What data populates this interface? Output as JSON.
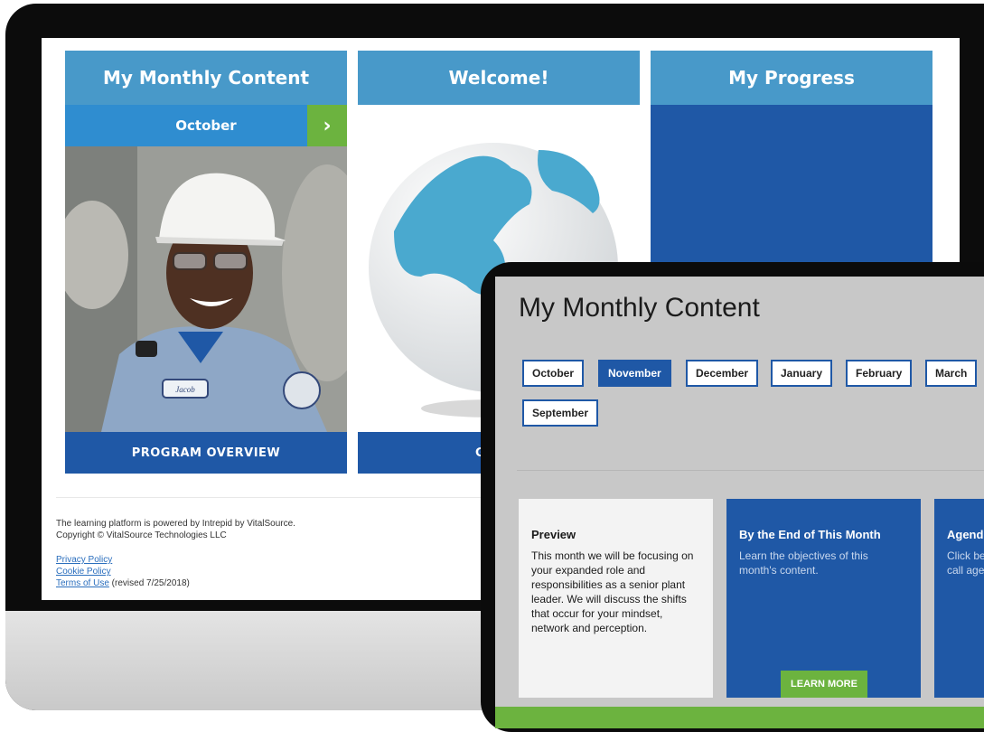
{
  "monitor": {
    "tiles": {
      "content": {
        "title": "My Monthly Content",
        "month": "October",
        "next_icon": "chevron-right-icon",
        "footer": "PROGRAM OVERVIEW",
        "badge_name": "Jacob"
      },
      "welcome": {
        "title": "Welcome!",
        "footer": "GLOBA"
      },
      "progress": {
        "title": "My Progress"
      }
    },
    "footer": {
      "powered": "The learning platform is powered by Intrepid by VitalSource.",
      "copyright": "Copyright © VitalSource Technologies LLC",
      "privacy": "Privacy Policy",
      "cookie": "Cookie Policy",
      "terms": "Terms of Use",
      "revised": " (revised 7/25/2018)"
    }
  },
  "tablet": {
    "title": "My Monthly Content",
    "months": [
      "October",
      "November",
      "December",
      "January",
      "February",
      "March",
      "September"
    ],
    "active_month": "November",
    "cards": {
      "preview": {
        "title": "Preview",
        "body": "This month we will be focusing on your expanded role and responsibilities as a senior plant leader. We will discuss the shifts that occur for your mindset, network and perception."
      },
      "end": {
        "title": "By the End of This Month",
        "body": "Learn the objectives of this month's content.",
        "button": "LEARN MORE"
      },
      "agenda": {
        "title": "Agend",
        "body": "Click be call age"
      }
    }
  },
  "colors": {
    "header_blue": "#4899c9",
    "month_bar_blue": "#2f8dd0",
    "dark_blue": "#1f58a6",
    "green": "#6cb33f"
  }
}
